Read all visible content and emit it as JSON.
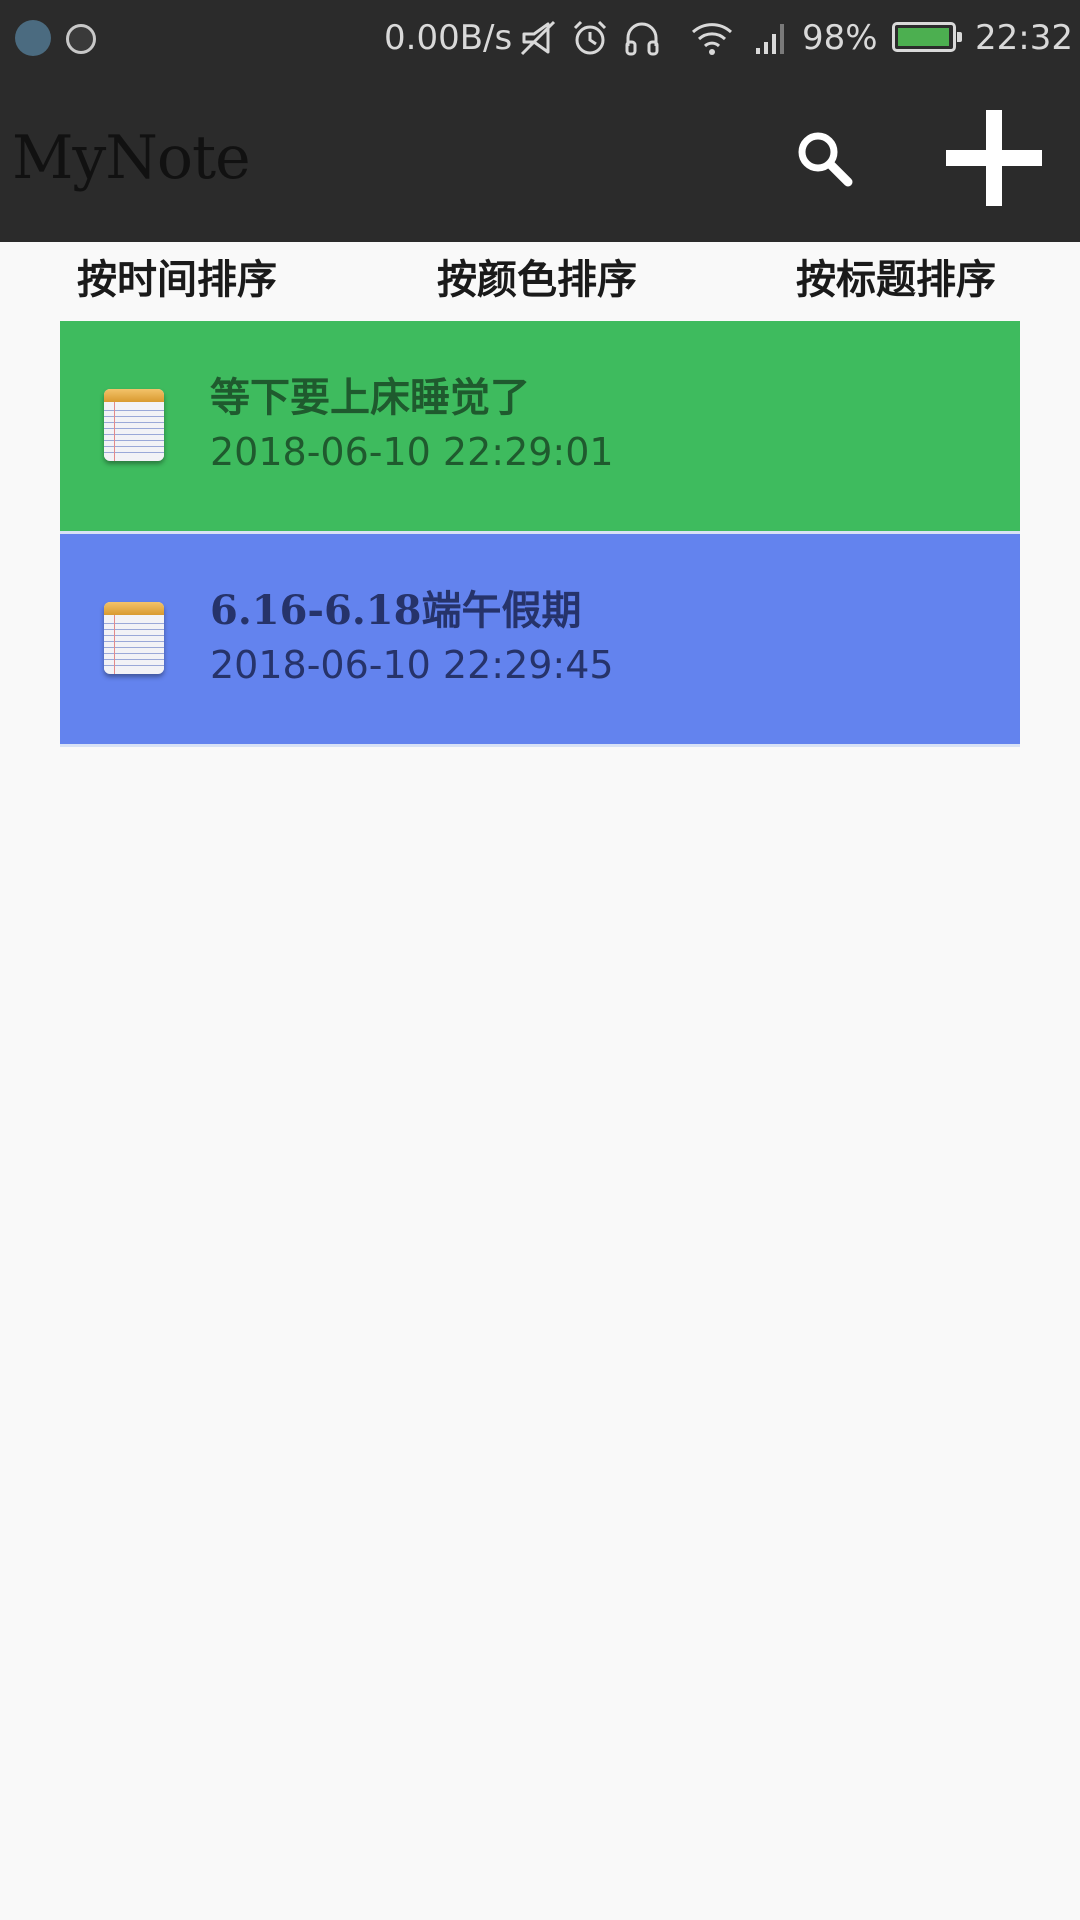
{
  "status_bar": {
    "net_speed": "0.00B/s",
    "battery_percent": "98%",
    "battery_level": 0.98,
    "time": "22:32",
    "icons": [
      "app-notification-icon",
      "app-notification-icon-2",
      "vibrate-icon",
      "alarm-icon",
      "headphones-icon",
      "wifi-icon",
      "cell-signal-icon",
      "battery-icon"
    ]
  },
  "app_bar": {
    "title": "MyNote",
    "search_icon": "search-icon",
    "add_icon": "plus-icon"
  },
  "sort_tabs": {
    "by_time": "按时间排序",
    "by_color": "按颜色排序",
    "by_title": "按标题排序"
  },
  "notes": [
    {
      "title": "等下要上床睡觉了",
      "date": "2018-06-10  22:29:01",
      "bg_color": "#3ebb5e",
      "text_color": "#1f5a2e",
      "icon": "notepad-icon"
    },
    {
      "title": "6.16-6.18端午假期",
      "date": "2018-06-10  22:29:45",
      "bg_color": "#6383ee",
      "text_color": "#26336a",
      "icon": "notepad-icon"
    }
  ],
  "colors": {
    "app_bar_bg": "#2b2b2b",
    "page_bg": "#f9f9f9"
  }
}
